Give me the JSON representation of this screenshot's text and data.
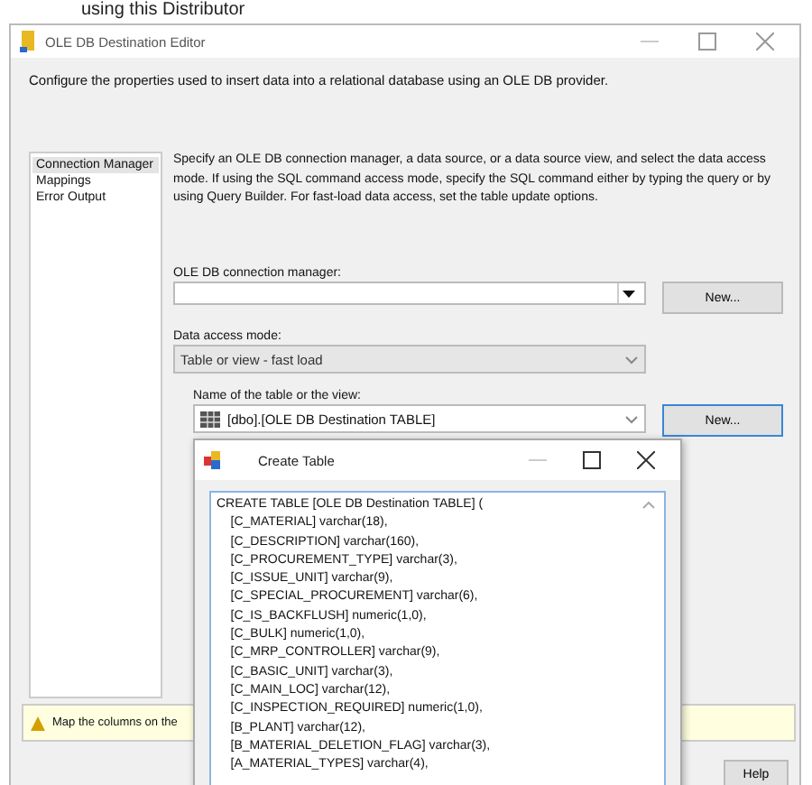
{
  "background_text": "using this Distributor",
  "window": {
    "title": "OLE DB Destination Editor"
  },
  "description": "Configure the properties used to insert data into a relational database using an OLE DB provider.",
  "sidebar": {
    "items": [
      {
        "label": "Connection Manager",
        "selected": true
      },
      {
        "label": "Mappings",
        "selected": false
      },
      {
        "label": "Error Output",
        "selected": false
      }
    ]
  },
  "instructions": "Specify an OLE DB connection manager, a data source, or a data source view, and select the data access mode. If using the SQL command access mode, specify the SQL command either by typing the query or by using Query Builder. For fast-load data access, set the table update options.",
  "connection_manager": {
    "label": "OLE DB connection manager:",
    "button": "New..."
  },
  "access_mode": {
    "label": "Data access mode:",
    "value": "Table or view - fast load",
    "disabled": true
  },
  "table_name": {
    "label": "Name of the table or the view:",
    "value": "[dbo].[OLE DB Destination TABLE]",
    "button": "New..."
  },
  "warning": "Map the columns on the",
  "help_button": "Help",
  "dialog": {
    "title": "Create Table",
    "lines": [
      "CREATE TABLE [OLE DB Destination TABLE] (",
      "    [C_MATERIAL] varchar(18),",
      "    [C_DESCRIPTION] varchar(160),",
      "    [C_PROCUREMENT_TYPE] varchar(3),",
      "    [C_ISSUE_UNIT] varchar(9),",
      "    [C_SPECIAL_PROCUREMENT] varchar(6),",
      "    [C_IS_BACKFLUSH] numeric(1,0),",
      "    [C_BULK] numeric(1,0),",
      "    [C_MRP_CONTROLLER] varchar(9),",
      "    [C_BASIC_UNIT] varchar(3),",
      "    [C_MAIN_LOC] varchar(12),",
      "    [C_INSPECTION_REQUIRED] numeric(1,0),",
      "    [B_PLANT] varchar(12),",
      "    [B_MATERIAL_DELETION_FLAG] varchar(3),",
      "    [A_MATERIAL_TYPES] varchar(4),"
    ]
  }
}
